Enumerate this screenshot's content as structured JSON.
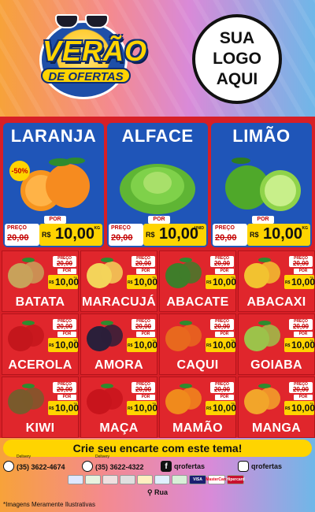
{
  "header": {
    "brand_line1": "VERÃO",
    "brand_line2": "DE OFERTAS",
    "logo_placeholder": [
      "SUA",
      "LOGO",
      "AQUI"
    ]
  },
  "featured": [
    {
      "name": "LARANJA",
      "discount": "-50%",
      "old_label": "PREÇO",
      "old_price": "20,00",
      "por": "POR",
      "currency": "R$",
      "price": "10,00",
      "unit": "KG",
      "icon": "orange-image"
    },
    {
      "name": "ALFACE",
      "discount": "",
      "old_label": "PREÇO",
      "old_price": "20,00",
      "por": "POR",
      "currency": "R$",
      "price": "10,00",
      "unit": "UNID",
      "icon": "lettuce-image"
    },
    {
      "name": "LIMÃO",
      "discount": "",
      "old_label": "PREÇO",
      "old_price": "20,00",
      "por": "POR",
      "currency": "R$",
      "price": "10,00",
      "unit": "KG",
      "icon": "lime-image"
    }
  ],
  "products": [
    {
      "name": "BATATA",
      "old_label": "PREÇO",
      "old_price": "20,00",
      "por": "POR",
      "currency": "R$",
      "price": "10,00",
      "unit": "KG",
      "color": "#c8a15a"
    },
    {
      "name": "MARACUJÁ",
      "old_label": "PREÇO",
      "old_price": "20,00",
      "por": "POR",
      "currency": "R$",
      "price": "10,00",
      "unit": "KG",
      "color": "#f3d35a"
    },
    {
      "name": "ABACATE",
      "old_label": "PREÇO",
      "old_price": "20,00",
      "por": "POR",
      "currency": "R$",
      "price": "10,00",
      "unit": "KG",
      "color": "#3f7d2a"
    },
    {
      "name": "ABACAXI",
      "old_label": "PREÇO",
      "old_price": "20,00",
      "por": "POR",
      "currency": "R$",
      "price": "10,00",
      "unit": "KG",
      "color": "#f2c230"
    },
    {
      "name": "ACEROLA",
      "old_label": "PREÇO",
      "old_price": "20,00",
      "por": "POR",
      "currency": "R$",
      "price": "10,00",
      "unit": "KG",
      "color": "#c4161c"
    },
    {
      "name": "AMORA",
      "old_label": "PREÇO",
      "old_price": "20,00",
      "por": "POR",
      "currency": "R$",
      "price": "10,00",
      "unit": "KG",
      "color": "#2b1f3a"
    },
    {
      "name": "CAQUI",
      "old_label": "PREÇO",
      "old_price": "20,00",
      "por": "POR",
      "currency": "R$",
      "price": "10,00",
      "unit": "KG",
      "color": "#e8681e"
    },
    {
      "name": "GOIABA",
      "old_label": "PREÇO",
      "old_price": "20,00",
      "por": "POR",
      "currency": "R$",
      "price": "10,00",
      "unit": "KG",
      "color": "#9cc24a"
    },
    {
      "name": "KIWI",
      "old_label": "PREÇO",
      "old_price": "20,00",
      "por": "POR",
      "currency": "R$",
      "price": "10,00",
      "unit": "KG",
      "color": "#7a5a2c"
    },
    {
      "name": "MAÇA",
      "old_label": "PREÇO",
      "old_price": "20,00",
      "por": "POR",
      "currency": "R$",
      "price": "10,00",
      "unit": "KG",
      "color": "#c8141c"
    },
    {
      "name": "MAMÃO",
      "old_label": "PREÇO",
      "old_price": "20,00",
      "por": "POR",
      "currency": "R$",
      "price": "10,00",
      "unit": "KG",
      "color": "#f08a1c"
    },
    {
      "name": "MANGA",
      "old_label": "PREÇO",
      "old_price": "20,00",
      "por": "POR",
      "currency": "R$",
      "price": "10,00",
      "unit": "KG",
      "color": "#f2a52a"
    }
  ],
  "footer": {
    "cta": "Crie seu encarte com este tema!",
    "whatsapp_label": "Delivery",
    "whatsapp_number": "(35) 3622-4674",
    "phone_label": "Delivery",
    "phone_number": "(35) 3622-4322",
    "facebook": "qrofertas",
    "instagram": "qrofertas",
    "payments": [
      "",
      "",
      "",
      "",
      "",
      "",
      "",
      "VISA",
      "MasterCard",
      "Hipercard"
    ],
    "address": "Rua",
    "disclaimer": "*Imagens Meramente Ilustrativas"
  },
  "colors": {
    "red": "#d71f26",
    "blue": "#1f55b8",
    "yellow": "#ffd400"
  }
}
